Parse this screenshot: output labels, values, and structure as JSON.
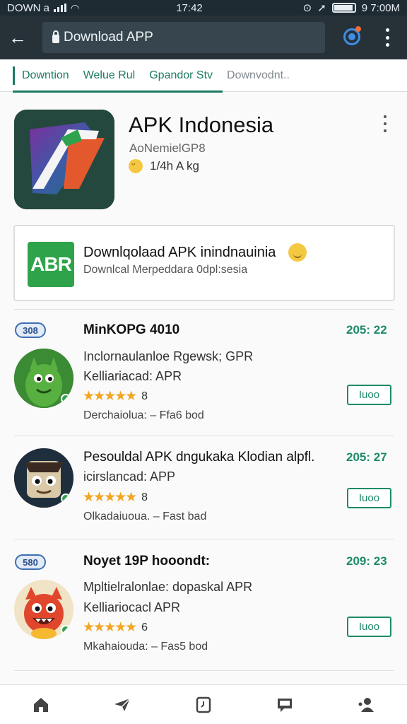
{
  "status_bar": {
    "left": "DOWN a",
    "time": "17:42",
    "right": "9 7:00M"
  },
  "app_bar": {
    "url": "Download APP"
  },
  "tabs": [
    {
      "label": "Downtion"
    },
    {
      "label": "Welue Rul"
    },
    {
      "label": "Gpandor Stv"
    },
    {
      "label": "Downvodnt.."
    }
  ],
  "hero": {
    "title": "APK Indonesia",
    "subtitle": "AoNemielGP8",
    "rating": "1/4h A kg"
  },
  "download_card": {
    "logo": "ABR",
    "title": "Downlqolaad APK inindnauinia",
    "subtitle": "Downlcal Merpeddara 0dpl:sesia"
  },
  "items": [
    {
      "badge": "308",
      "title": "MinKOPG 4010",
      "line2": "Inclornaulanloe Rgewsk; GPR",
      "line3": "Kelliariacad: APR",
      "stars": "★★★★★",
      "count": "8",
      "meta": "Derchaiolua: – Ffa6 bod",
      "price": "205: 22",
      "button": "Iuoo"
    },
    {
      "badge": "",
      "title": "Pesouldal APK dngukaka Klodian alpfl.",
      "line2": "icirslancad: APP",
      "line3": "",
      "stars": "★★★★★",
      "count": "8",
      "meta": "Olkadaiuoua. – Fast bad",
      "price": "205: 27",
      "button": "Iuoo"
    },
    {
      "badge": "580",
      "title": "Noyet 19P hooondt:",
      "line2": "Mpltielralonlae: dopaskal APR",
      "line3": "Kelliariocacl APR",
      "stars": "★★★★★",
      "count": "6",
      "meta": "Mkahaiouda: – Fas5 bod",
      "price": "209: 23",
      "button": "Iuoo"
    }
  ],
  "bottom_nav": [
    {
      "icon": "home-icon"
    },
    {
      "icon": "send-icon"
    },
    {
      "icon": "clock-icon"
    },
    {
      "icon": "chat-icon"
    },
    {
      "icon": "people-icon"
    }
  ]
}
